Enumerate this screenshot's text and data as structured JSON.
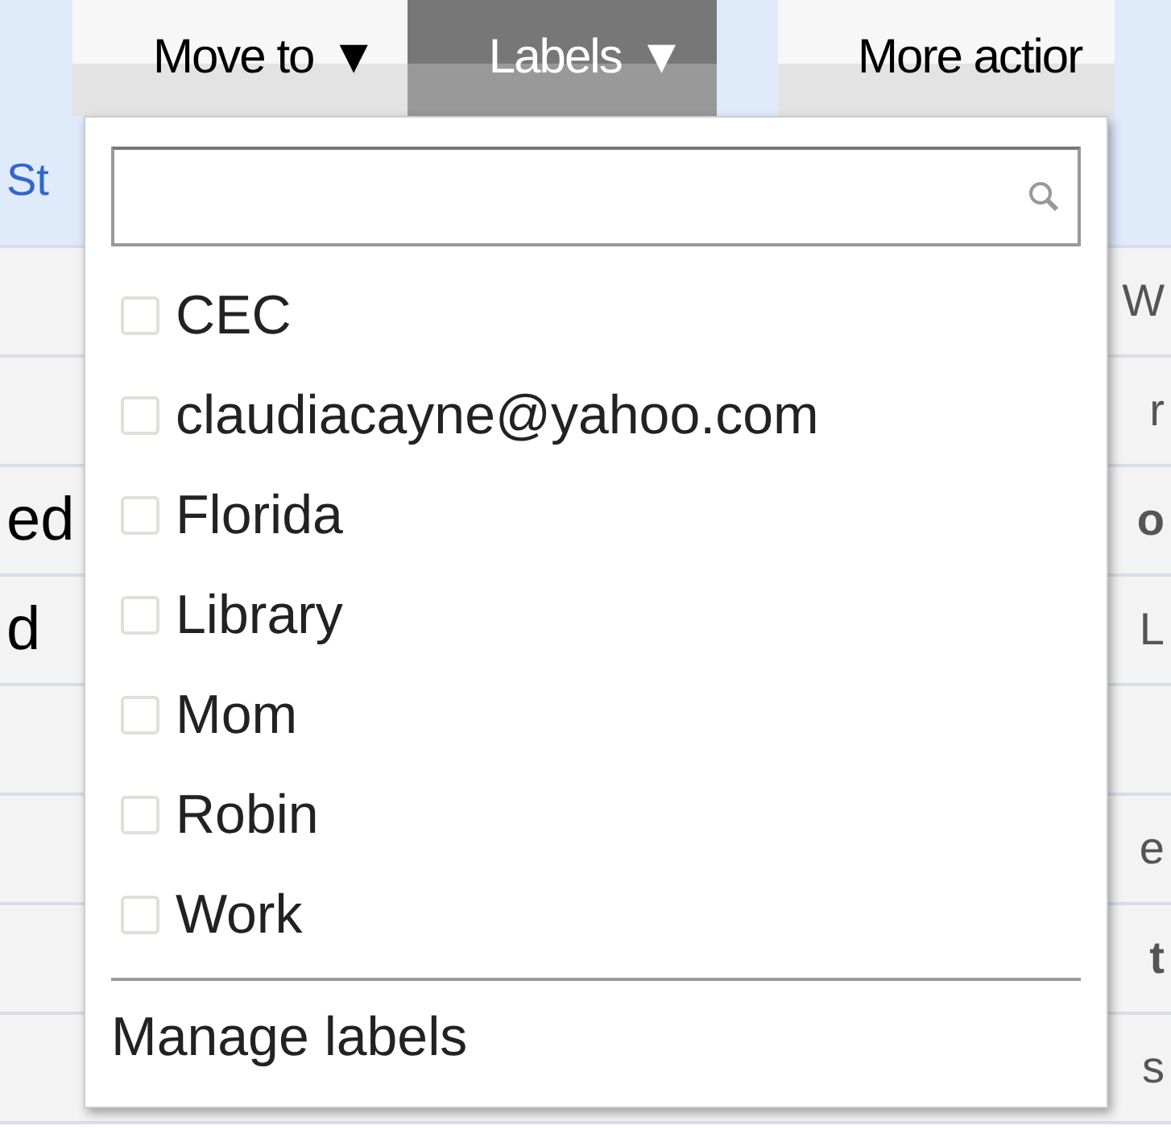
{
  "toolbar": {
    "buttons": [
      {
        "label": "Move to",
        "arrow": "▼",
        "selected": false
      },
      {
        "label": "Labels",
        "arrow": "▼",
        "selected": true
      },
      {
        "label": "More actior",
        "selected": false
      }
    ]
  },
  "background_rows": [
    {
      "left": "St",
      "kind": "header"
    },
    {
      "right": "W",
      "bold": false,
      "kind": "row"
    },
    {
      "right": "r",
      "bold": false,
      "kind": "row"
    },
    {
      "left": "ed",
      "right": "o",
      "bold": true,
      "kind": "row"
    },
    {
      "left": "d",
      "right": "L",
      "bold": false,
      "kind": "row"
    },
    {
      "kind": "row"
    },
    {
      "right": "e",
      "bold": false,
      "kind": "row"
    },
    {
      "right": "t",
      "bold": true,
      "kind": "row"
    },
    {
      "right": "s",
      "bold": false,
      "kind": "row"
    }
  ],
  "labels_menu": {
    "items": [
      {
        "label": "CEC",
        "checked": false
      },
      {
        "label": "claudiacayne@yahoo.com",
        "checked": false
      },
      {
        "label": "Florida",
        "checked": false
      },
      {
        "label": "Library",
        "checked": false
      },
      {
        "label": "Mom",
        "checked": false
      },
      {
        "label": "Robin",
        "checked": false
      },
      {
        "label": "Work",
        "checked": false
      }
    ],
    "footer": "Manage labels"
  }
}
